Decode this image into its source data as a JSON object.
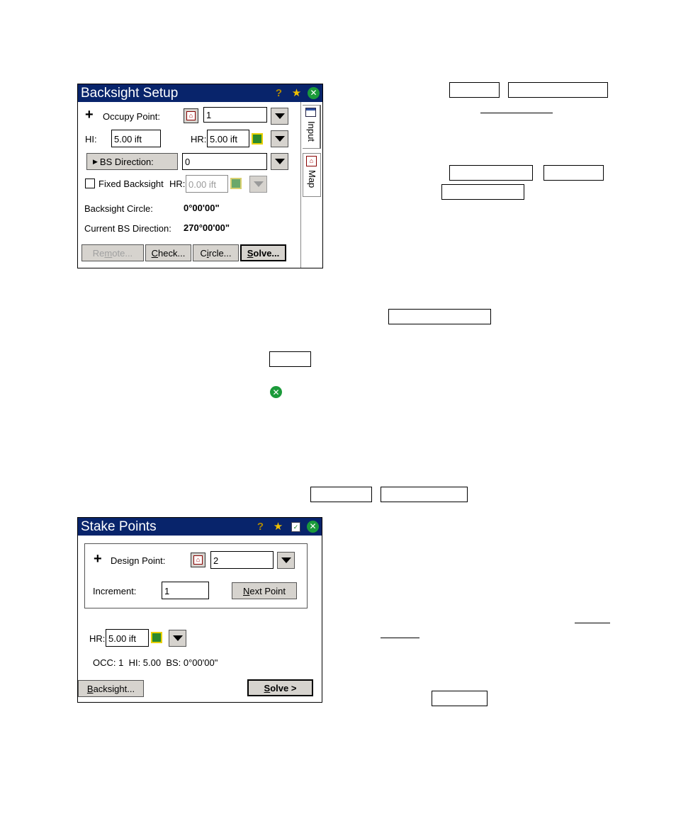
{
  "backsight": {
    "title": "Backsight Setup",
    "occupy_label": "Occupy Point:",
    "occupy_value": "1",
    "hi_label": "HI:",
    "hi_value": "5.00 ift",
    "hr_label": "HR:",
    "hr_value": "5.00 ift",
    "bs_direction_label": "BS Direction:",
    "bs_direction_value": "0",
    "fixed_label": "Fixed Backsight",
    "fixed_hr_label": "HR:",
    "fixed_hr_value": "0.00 ift",
    "circle_label": "Backsight Circle:",
    "circle_value": "0°00'00\"",
    "current_label": "Current BS Direction:",
    "current_value": "270°00'00\"",
    "btn_remote": {
      "pre": "Re",
      "u": "m",
      "post": "ote..."
    },
    "btn_check": {
      "pre": "",
      "u": "C",
      "post": "heck..."
    },
    "btn_circle": {
      "pre": "C",
      "u": "i",
      "post": "rcle..."
    },
    "btn_solve": {
      "pre": "",
      "u": "S",
      "post": "olve..."
    },
    "tab_input": "Input",
    "tab_map": "Map"
  },
  "stake": {
    "title": "Stake Points",
    "design_label": "Design Point:",
    "design_value": "2",
    "increment_label": "Increment:",
    "increment_value": "1",
    "btn_next": {
      "pre": "",
      "u": "N",
      "post": "ext Point"
    },
    "hr_label": "HR:",
    "hr_value": "5.00 ift",
    "status": "OCC: 1  HI: 5.00  BS: 0°00'00\"",
    "btn_backsight": {
      "pre": "",
      "u": "B",
      "post": "acksight..."
    },
    "btn_solve": {
      "pre": "",
      "u": "S",
      "post": "olve >"
    }
  },
  "icons": {
    "help": "question-mark-icon",
    "favorites": "star-icon",
    "close": "close-icon",
    "checklist": "checklist-icon",
    "map": "map-icon",
    "prism": "prism-icon",
    "dropdown": "chevron-down-icon"
  }
}
